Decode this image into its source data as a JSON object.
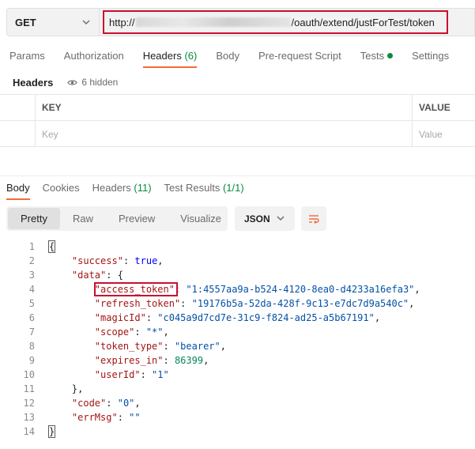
{
  "request": {
    "method": "GET",
    "url_prefix": "http://",
    "url_suffix": "/oauth/extend/justForTest/token"
  },
  "request_tabs": [
    {
      "label": "Params"
    },
    {
      "label": "Authorization"
    },
    {
      "label": "Headers",
      "count": "(6)"
    },
    {
      "label": "Body"
    },
    {
      "label": "Pre-request Script"
    },
    {
      "label": "Tests"
    },
    {
      "label": "Settings"
    }
  ],
  "headers_panel": {
    "title": "Headers",
    "hidden_label": "6 hidden",
    "columns": {
      "key": "KEY",
      "value": "VALUE"
    },
    "placeholders": {
      "key": "Key",
      "value": "Value"
    }
  },
  "response_tabs": [
    {
      "label": "Body"
    },
    {
      "label": "Cookies"
    },
    {
      "label": "Headers",
      "count": "(11)"
    },
    {
      "label": "Test Results",
      "count": "(1/1)"
    }
  ],
  "format": {
    "modes": [
      "Pretty",
      "Raw",
      "Preview",
      "Visualize"
    ],
    "language": "JSON"
  },
  "response_body": {
    "line_numbers": [
      "1",
      "2",
      "3",
      "4",
      "5",
      "6",
      "7",
      "8",
      "9",
      "10",
      "11",
      "12",
      "13",
      "14"
    ],
    "success_key": "\"success\"",
    "success_val": "true",
    "data_key": "\"data\"",
    "access_token_key": "\"access_token\"",
    "access_token_val": "\"1:4557aa9a-b524-4120-8ea0-d4233a16efa3\"",
    "refresh_token_key": "\"refresh_token\"",
    "refresh_token_val": "\"19176b5a-52da-428f-9c13-e7dc7d9a540c\"",
    "magic_id_key": "\"magicId\"",
    "magic_id_val": "\"c045a9d7cd7e-31c9-f824-ad25-a5b67191\"",
    "scope_key": "\"scope\"",
    "scope_val": "\"*\"",
    "token_type_key": "\"token_type\"",
    "token_type_val": "\"bearer\"",
    "expires_in_key": "\"expires_in\"",
    "expires_in_val": "86399",
    "user_id_key": "\"userId\"",
    "user_id_val": "\"1\"",
    "code_key": "\"code\"",
    "code_val": "\"0\"",
    "err_msg_key": "\"errMsg\"",
    "err_msg_val": "\"\""
  },
  "colors": {
    "accent": "#f26b3a",
    "highlight_box": "#c8102e",
    "success_green": "#0a8a3c"
  },
  "icons": {
    "method_dropdown": "chevron-down-icon",
    "hidden_headers": "eye-icon",
    "format_dropdown": "chevron-down-icon",
    "wrap_lines": "wrap-lines-icon"
  }
}
